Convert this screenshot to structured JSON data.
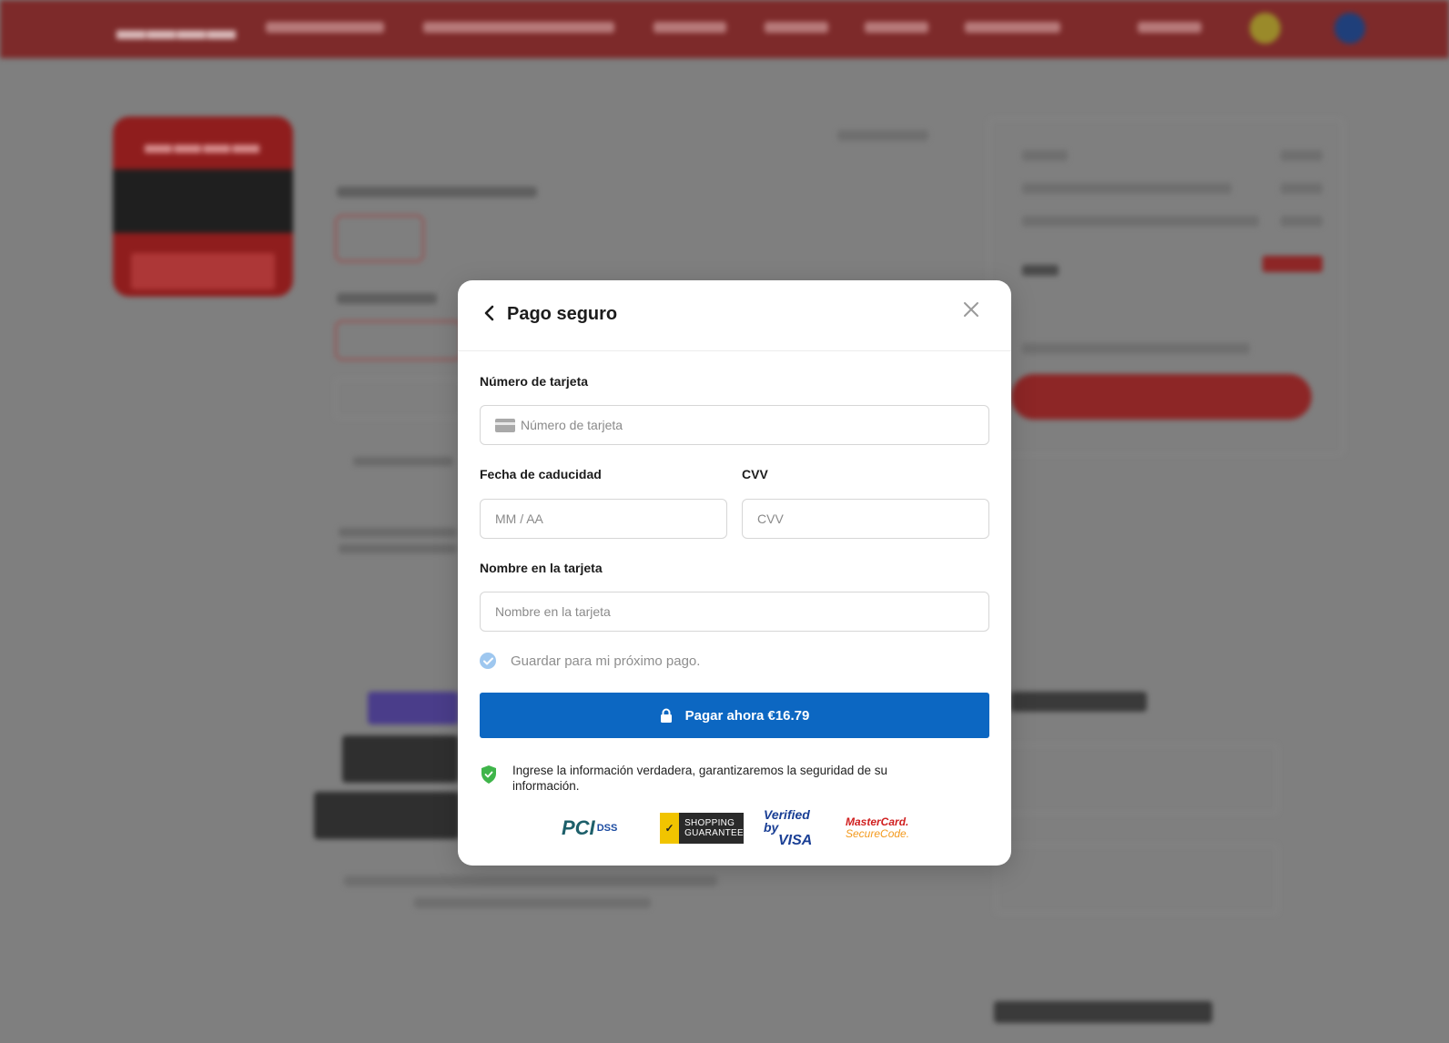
{
  "modal": {
    "title": "Pago seguro",
    "card_number": {
      "label": "Número de tarjeta",
      "placeholder": "Número de tarjeta"
    },
    "expiry": {
      "label": "Fecha de caducidad",
      "placeholder": "MM / AA"
    },
    "cvv": {
      "label": "CVV",
      "placeholder": "CVV"
    },
    "name": {
      "label": "Nombre en la tarjeta",
      "placeholder": "Nombre en la tarjeta"
    },
    "save_label": "Guardar para mi próximo pago.",
    "pay_button": "Pagar ahora €16.79",
    "security_note": "Ingrese la información verdadera, garantizaremos la seguridad de su información.",
    "badges": {
      "pci": {
        "mark": "PCI",
        "text": "DSS"
      },
      "norton": {
        "line1": "SHOPPING",
        "line2": "GUARANTEE"
      },
      "visa": {
        "line1": "Verified by",
        "line2": "VISA"
      },
      "mastercard": {
        "line1": "MasterCard.",
        "line2": "SecureCode."
      }
    }
  },
  "background": {
    "brand_color": "#c62828",
    "overlay_color": "#7f7f7f"
  },
  "colors": {
    "accent": "#0c67c2",
    "check": "#9ec7ef",
    "shield": "#3fb54a"
  }
}
